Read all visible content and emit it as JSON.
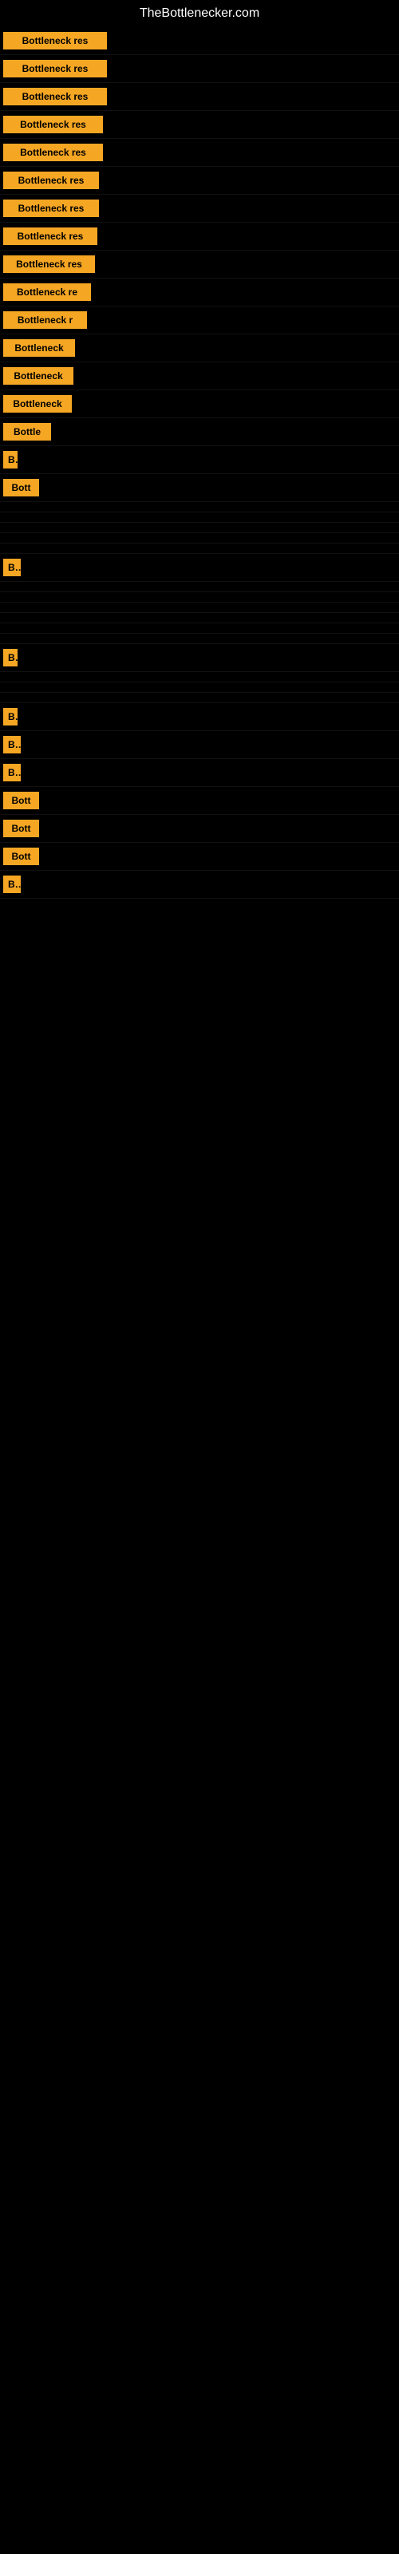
{
  "header": {
    "title": "TheBottlenecker.com"
  },
  "rows": [
    {
      "label": "Bottleneck res",
      "width": 130
    },
    {
      "label": "Bottleneck res",
      "width": 130
    },
    {
      "label": "Bottleneck res",
      "width": 130
    },
    {
      "label": "Bottleneck res",
      "width": 125
    },
    {
      "label": "Bottleneck res",
      "width": 125
    },
    {
      "label": "Bottleneck res",
      "width": 120
    },
    {
      "label": "Bottleneck res",
      "width": 120
    },
    {
      "label": "Bottleneck res",
      "width": 118
    },
    {
      "label": "Bottleneck res",
      "width": 115
    },
    {
      "label": "Bottleneck re",
      "width": 110
    },
    {
      "label": "Bottleneck r",
      "width": 105
    },
    {
      "label": "Bottleneck",
      "width": 90
    },
    {
      "label": "Bottleneck",
      "width": 88
    },
    {
      "label": "Bottleneck",
      "width": 86
    },
    {
      "label": "Bottle",
      "width": 60
    },
    {
      "label": "B",
      "width": 18
    },
    {
      "label": "Bott",
      "width": 45
    },
    {
      "label": "",
      "width": 0
    },
    {
      "label": "",
      "width": 0
    },
    {
      "label": "",
      "width": 0
    },
    {
      "label": "",
      "width": 0
    },
    {
      "label": "",
      "width": 0
    },
    {
      "label": "Bo",
      "width": 22
    },
    {
      "label": "",
      "width": 0
    },
    {
      "label": "",
      "width": 0
    },
    {
      "label": "",
      "width": 0
    },
    {
      "label": "",
      "width": 0
    },
    {
      "label": "",
      "width": 0
    },
    {
      "label": "",
      "width": 0
    },
    {
      "label": "B",
      "width": 18
    },
    {
      "label": "",
      "width": 0
    },
    {
      "label": "",
      "width": 0
    },
    {
      "label": "",
      "width": 0
    },
    {
      "label": "B",
      "width": 18
    },
    {
      "label": "Bo",
      "width": 22
    },
    {
      "label": "Bo",
      "width": 22
    },
    {
      "label": "Bott",
      "width": 45
    },
    {
      "label": "Bott",
      "width": 45
    },
    {
      "label": "Bott",
      "width": 45
    },
    {
      "label": "Bo",
      "width": 22
    }
  ]
}
